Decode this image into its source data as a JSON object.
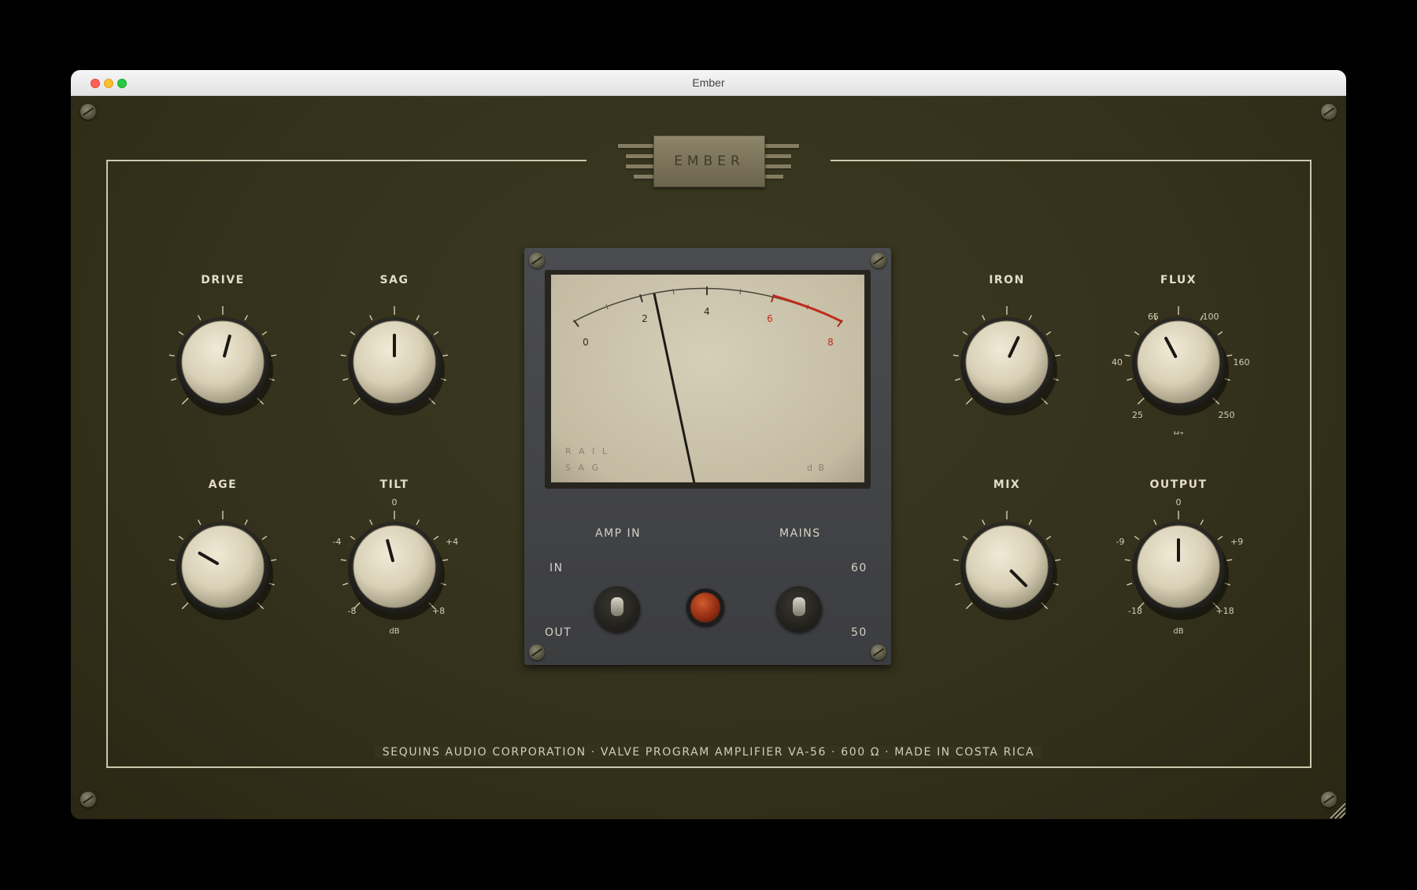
{
  "window": {
    "title": "Ember"
  },
  "brand": {
    "name": "EMBER"
  },
  "knobs": {
    "drive": {
      "label": "DRIVE"
    },
    "sag": {
      "label": "SAG"
    },
    "age": {
      "label": "AGE"
    },
    "tilt": {
      "label": "TILT",
      "scale": {
        "top": "0",
        "left": "-4",
        "right": "+4",
        "bottom_left": "-8",
        "bottom_right": "+8",
        "unit": "dB"
      }
    },
    "iron": {
      "label": "IRON"
    },
    "flux": {
      "label": "FLUX",
      "scale": {
        "top_left": "65",
        "top_right": "100",
        "left": "40",
        "right": "160",
        "bottom_left": "25",
        "bottom_right": "250",
        "unit": "Hz"
      }
    },
    "mix": {
      "label": "MIX"
    },
    "output": {
      "label": "OUTPUT",
      "scale": {
        "top": "0",
        "left": "-9",
        "right": "+9",
        "bottom_left": "-18",
        "bottom_right": "+18",
        "unit": "dB"
      }
    }
  },
  "meter": {
    "scale": [
      "0",
      "2",
      "4",
      "6",
      "8"
    ],
    "caption_top": "R A I L",
    "caption_bottom": "S A G",
    "unit": "d B"
  },
  "controls": {
    "amp_in_label": "AMP IN",
    "mains_label": "MAINS",
    "in_label": "IN",
    "out_label": "OUT",
    "hz60_label": "60",
    "hz50_label": "50"
  },
  "footer": {
    "text": "SEQUINS AUDIO CORPORATION  ·  VALVE PROGRAM AMPLIFIER VA-56  ·  600 Ω  ·  MADE IN COSTA RICA"
  },
  "colors": {
    "panel": "#34311c",
    "knob": "#d9d1b8",
    "meter_red": "#c02a1a",
    "metal_box": "#434447"
  }
}
